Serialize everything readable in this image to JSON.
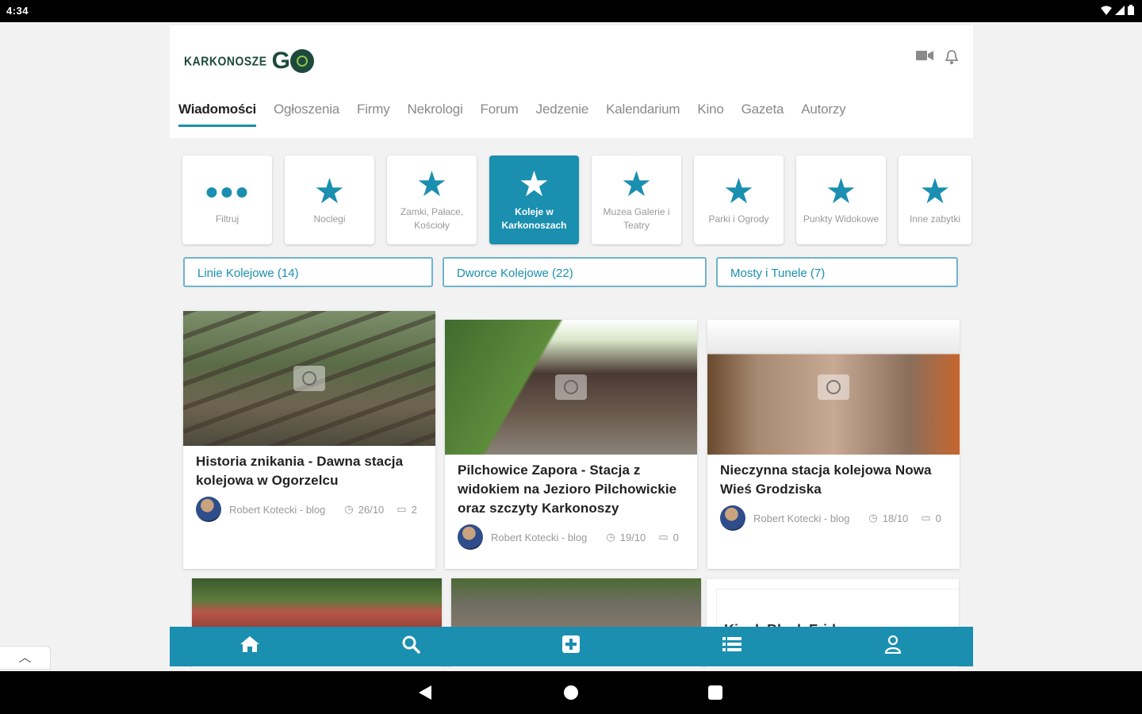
{
  "status": {
    "time": "4:34",
    "wifi_icon": "wifi-icon",
    "signal_icon": "signal-icon",
    "battery_icon": "battery-icon"
  },
  "header": {
    "logo_text": "KARKONOSZE",
    "logo_go": "G",
    "tabs": [
      {
        "label": "Wiadomości",
        "active": true
      },
      {
        "label": "Ogłoszenia"
      },
      {
        "label": "Firmy"
      },
      {
        "label": "Nekrologi"
      },
      {
        "label": "Forum"
      },
      {
        "label": "Jedzenie"
      },
      {
        "label": "Kalendarium"
      },
      {
        "label": "Kino"
      },
      {
        "label": "Gazeta"
      },
      {
        "label": "Autorzy"
      }
    ]
  },
  "categories": [
    {
      "label": "Filtruj",
      "icon": "more-dots-icon"
    },
    {
      "label": "Noclegi",
      "icon": "star-icon"
    },
    {
      "label": "Zamki, Pałace, Kościoły",
      "icon": "star-icon"
    },
    {
      "label": "Koleje w Karkonoszach",
      "icon": "star-icon",
      "active": true
    },
    {
      "label": "Muzea Galerie i Teatry",
      "icon": "star-icon"
    },
    {
      "label": "Parki i Ogrody",
      "icon": "star-icon"
    },
    {
      "label": "Punkty Widokowe",
      "icon": "star-icon"
    },
    {
      "label": "Inne zabytki",
      "icon": "star-icon"
    }
  ],
  "chips": [
    {
      "label": "Linie Kolejowe (14)"
    },
    {
      "label": "Dworce Kolejowe (22)"
    },
    {
      "label": "Mosty i Tunele (7)"
    }
  ],
  "articles": [
    {
      "title": "Historia znikania - Dawna stacja kolejowa w Ogorzelcu",
      "author": "Robert Kotecki - blog",
      "date": "26/10",
      "comments": "2"
    },
    {
      "title": "Pilchowice Zapora - Stacja z widokiem na Jezioro Pilchowickie oraz szczyty Karkonoszy",
      "author": "Robert Kotecki - blog",
      "date": "19/10",
      "comments": "0"
    },
    {
      "title": "Nieczynna stacja kolejowa Nowa Wieś Grodziska",
      "author": "Robert Kotecki - blog",
      "date": "18/10",
      "comments": "0"
    }
  ],
  "partial_card_text": "Kiosk Black Friday",
  "bottom_nav": [
    {
      "icon": "home-icon",
      "glyph": "⌂"
    },
    {
      "icon": "search-icon",
      "glyph": "⚲"
    },
    {
      "icon": "add-box-icon",
      "glyph": "⊞"
    },
    {
      "icon": "list-icon",
      "glyph": "☰"
    },
    {
      "icon": "user-icon",
      "glyph": "⚇"
    }
  ],
  "colors": {
    "accent": "#1a8fb0",
    "logo": "#1d4a3c"
  }
}
